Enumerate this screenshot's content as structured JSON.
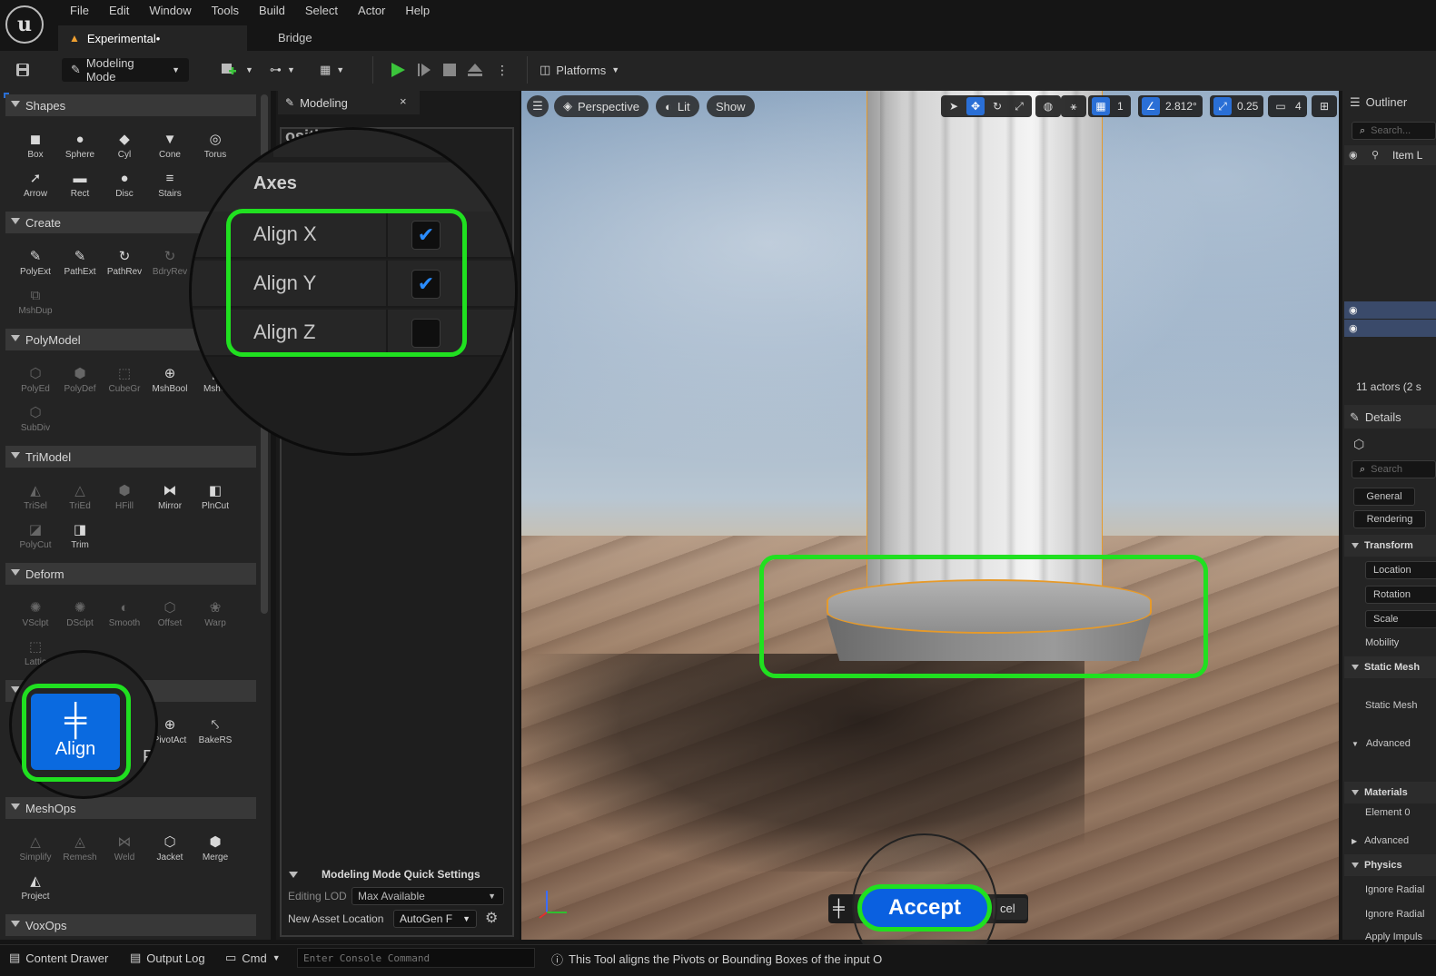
{
  "menubar": {
    "logo": "u",
    "items": [
      "File",
      "Edit",
      "Window",
      "Tools",
      "Build",
      "Select",
      "Actor",
      "Help"
    ],
    "tabs": [
      "Experimental•",
      "Bridge"
    ]
  },
  "toolbar": {
    "mode_label": "Modeling Mode",
    "platforms_label": "Platforms"
  },
  "left_panel": {
    "categories": [
      "Shapes",
      "Create",
      "PolyModel",
      "TriModel",
      "Deform",
      "MeshOps",
      "VoxOps"
    ],
    "shapes": [
      "Box",
      "Sphere",
      "Cyl",
      "Cone",
      "Torus",
      "Arrow",
      "Rect",
      "Disc",
      "Stairs"
    ],
    "create": [
      "PolyExt",
      "PathExt",
      "PathRev",
      "BdryRev",
      "MshDup"
    ],
    "polymodel": [
      "PolyEd",
      "PolyDef",
      "CubeGr",
      "MshBool",
      "MshC",
      "SubDiv"
    ],
    "trimodel": [
      "TriSel",
      "TriEd",
      "HFill",
      "Mirror",
      "PlnCut",
      "PolyCut",
      "Trim"
    ],
    "deform": [
      "VSclpt",
      "DSclpt",
      "Smooth",
      "Offset",
      "Warp",
      "Lattic"
    ],
    "transform": [
      "PivotAct",
      "BakeRS",
      "P",
      "Tran"
    ],
    "meshops": [
      "Simplify",
      "Remesh",
      "Weld",
      "Jacket",
      "Merge",
      "Project"
    ],
    "align_button": "Align"
  },
  "modeling_panel": {
    "tab_label": "Modeling",
    "close": "×",
    "clipped_header": "osition",
    "axes_title": "Axes",
    "axes": [
      {
        "label": "Align X",
        "checked": true
      },
      {
        "label": "Align Y",
        "checked": true
      },
      {
        "label": "Align Z",
        "checked": false
      }
    ],
    "check_glyph": "✔",
    "quick_settings_title": "Modeling Mode Quick Settings",
    "editing_lod_label": "Editing LOD",
    "editing_lod_value": "Max Available",
    "asset_location_label": "New Asset Location",
    "asset_location_value": "AutoGen F"
  },
  "viewport": {
    "perspective": "Perspective",
    "lit": "Lit",
    "show": "Show",
    "grid_value": "1",
    "angle_value": "2.812°",
    "scale_value": "0.25",
    "camera_speed": "4",
    "accept": "Accept",
    "cancel": "cel"
  },
  "outliner": {
    "title": "Outliner",
    "search_placeholder": "Search...",
    "column": "Item L",
    "actors_count": "11 actors (2 s"
  },
  "details": {
    "title": "Details",
    "search_placeholder": "Search",
    "tabs": [
      "General",
      "Rendering"
    ],
    "transform_header": "Transform",
    "location": "Location",
    "rotation": "Rotation",
    "scale": "Scale",
    "mobility": "Mobility",
    "static_mesh_header": "Static Mesh",
    "static_mesh_label": "Static Mesh",
    "advanced": "Advanced",
    "materials_header": "Materials",
    "element0": "Element 0",
    "advanced2": "Advanced",
    "physics_header": "Physics",
    "ignore_radial1": "Ignore Radial",
    "ignore_radial2": "Ignore Radial",
    "apply_impulse": "Apply Impuls"
  },
  "statusbar": {
    "content_drawer": "Content Drawer",
    "output_log": "Output Log",
    "cmd": "Cmd",
    "console_placeholder": "Enter Console Command",
    "hint": "This Tool aligns the Pivots or Bounding Boxes of the input O"
  },
  "colors": {
    "highlight": "#20e020",
    "accent_blue": "#0a60e0",
    "selection_outline": "#e69a2a"
  }
}
